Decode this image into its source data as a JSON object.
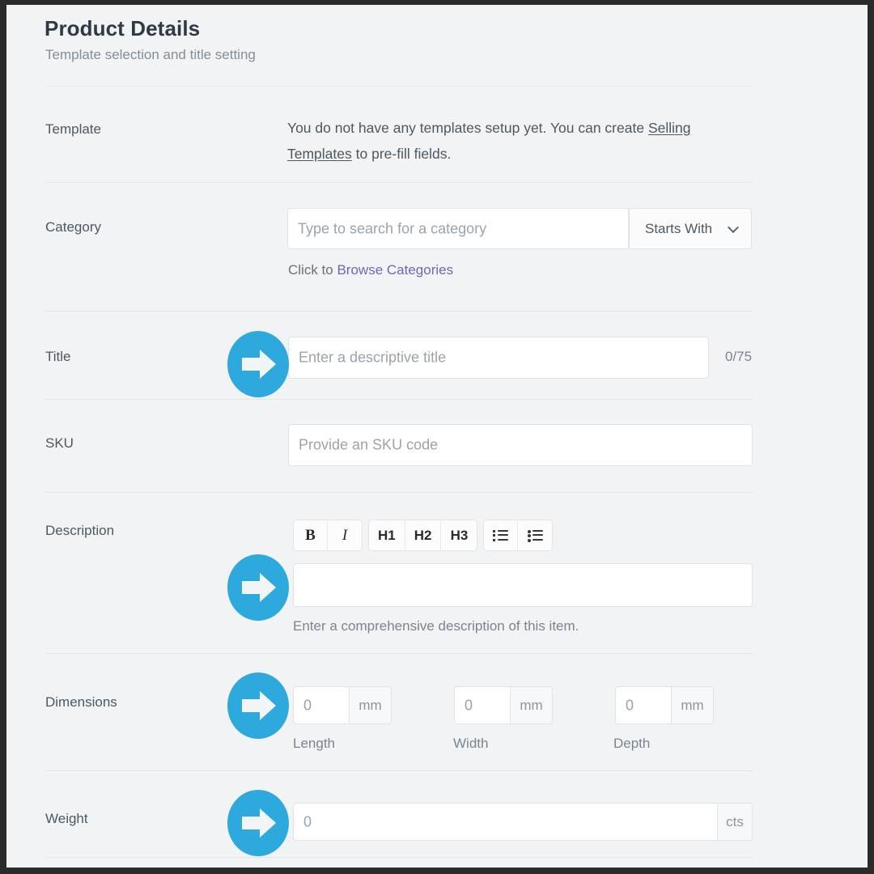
{
  "header": {
    "title": "Product Details",
    "subtitle": "Template selection and title setting"
  },
  "accent": {
    "annotation_blue": "#2ea9dd",
    "link_purple": "#7165b8",
    "page_background": "#f1f3f4",
    "field_border": "#dfe3e6"
  },
  "rows": {
    "template": {
      "label": "Template",
      "text_before": "You do not have any templates setup yet. You can create ",
      "link": "Selling Templates",
      "text_after": " to pre-fill fields."
    },
    "category": {
      "label": "Category",
      "search_placeholder": "Type to search for a category",
      "match_mode": "Starts With",
      "match_mode_options": [
        "Starts With"
      ],
      "browse_prefix": "Click to ",
      "browse_link": "Browse Categories",
      "chevron_icon": "chevron-down-icon"
    },
    "title": {
      "label": "Title",
      "placeholder": "Enter a descriptive title",
      "counter": "0/75",
      "annotation_icon": "arrow-right-icon"
    },
    "sku": {
      "label": "SKU",
      "placeholder": "Provide an SKU code"
    },
    "description": {
      "label": "Description",
      "toolbar": {
        "group1": [
          {
            "label": "B",
            "name": "bold-button"
          },
          {
            "label": "I",
            "name": "italic-button"
          }
        ],
        "group2": [
          {
            "label": "H1",
            "name": "heading1-button"
          },
          {
            "label": "H2",
            "name": "heading2-button"
          },
          {
            "label": "H3",
            "name": "heading3-button"
          }
        ],
        "group3": [
          {
            "label": "",
            "name": "ordered-list-icon"
          },
          {
            "label": "",
            "name": "unordered-list-icon"
          }
        ]
      },
      "value": "",
      "help": "Enter a comprehensive description of this item.",
      "annotation_icon": "arrow-right-icon"
    },
    "dimensions": {
      "label": "Dimensions",
      "annotation_icon": "arrow-right-icon",
      "fields": [
        {
          "placeholder": "0",
          "unit": "mm",
          "caption": "Length"
        },
        {
          "placeholder": "0",
          "unit": "mm",
          "caption": "Width"
        },
        {
          "placeholder": "0",
          "unit": "mm",
          "caption": "Depth"
        }
      ]
    },
    "weight": {
      "label": "Weight",
      "placeholder": "0",
      "unit": "cts",
      "annotation_icon": "arrow-right-icon"
    }
  }
}
